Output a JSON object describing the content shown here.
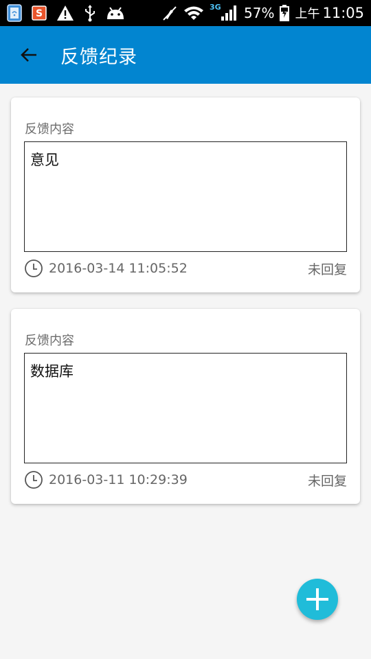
{
  "status_bar": {
    "icons_left": [
      "sim-card-icon",
      "weibo-app-icon",
      "warning-icon",
      "usb-icon",
      "android-debug-icon"
    ],
    "icons_right": [
      "vibrate-off-icon",
      "wifi-icon",
      "signal-3g-icon",
      "battery-charging-icon"
    ],
    "network_type": "3G",
    "battery_percent": "57%",
    "time_prefix": "上午",
    "time": "11:05"
  },
  "app_bar": {
    "title": "反馈纪录",
    "background_color": "#0285d0",
    "back_icon": "arrow-back-icon"
  },
  "feedback_items": [
    {
      "label": "反馈内容",
      "content": "意见",
      "timestamp": "2016-03-14 11:05:52",
      "status": "未回复"
    },
    {
      "label": "反馈内容",
      "content": "数据库",
      "timestamp": "2016-03-11 10:29:39",
      "status": "未回复"
    }
  ],
  "fab": {
    "icon": "plus-icon",
    "color": "#20bcd9"
  }
}
